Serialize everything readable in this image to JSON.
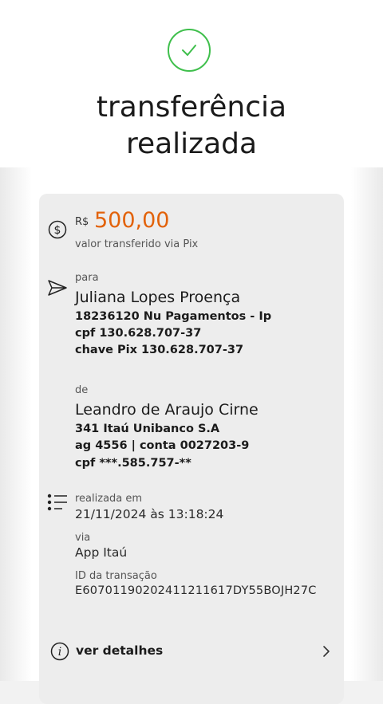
{
  "header": {
    "title_line1": "transferência",
    "title_line2": "realizada"
  },
  "amount": {
    "currency": "R$",
    "value": "500,00",
    "caption": "valor transferido via Pix"
  },
  "recipient": {
    "label": "para",
    "name": "Juliana Lopes Proença",
    "bank": "18236120 Nu Pagamentos - Ip",
    "cpf": "cpf 130.628.707-37",
    "pix_key": "chave Pix 130.628.707-37"
  },
  "sender": {
    "label": "de",
    "name": "Leandro de Araujo Cirne",
    "bank": "341 Itaú Unibanco S.A",
    "account": "ag 4556 | conta 0027203-9",
    "cpf": "cpf ***.585.757-**"
  },
  "details": {
    "date_label": "realizada em",
    "date_value": "21/11/2024 às 13:18:24",
    "via_label": "via",
    "via_value": "App Itaú",
    "id_label": "ID da transação",
    "id_value": "E60701190202411211617DY55BOJH27C"
  },
  "actions": {
    "details_label": "ver detalhes"
  },
  "colors": {
    "success": "#3fbf4c",
    "amount": "#e2620a",
    "card_bg": "#ededed"
  },
  "icons": {
    "success": "check-icon",
    "amount": "dollar-circle-icon",
    "recipient": "send-icon",
    "details": "list-icon",
    "info": "info-icon",
    "chevron": "chevron-right-icon"
  }
}
